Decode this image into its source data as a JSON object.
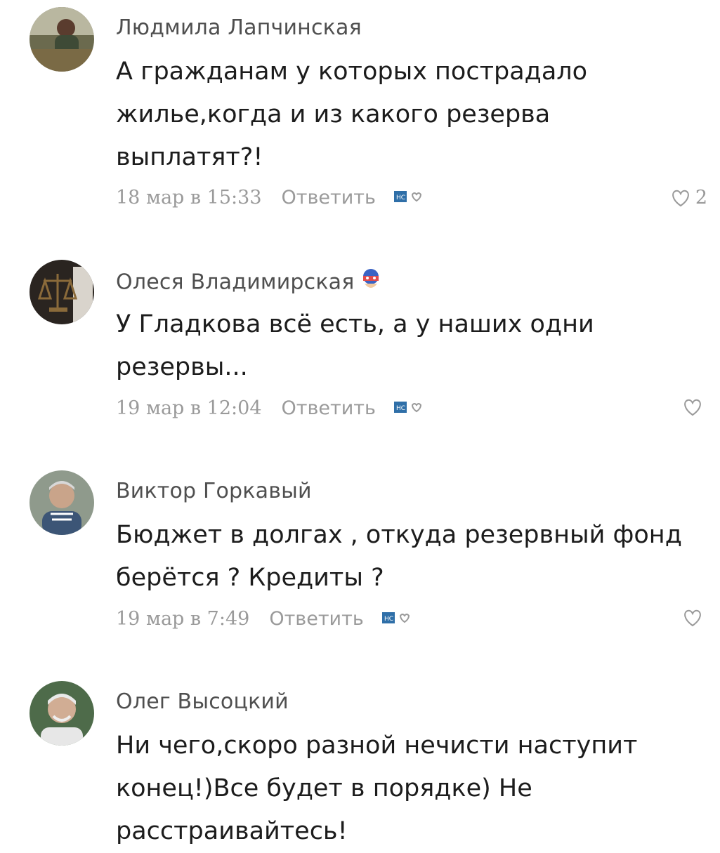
{
  "comments": [
    {
      "author": "Людмила Лапчинская",
      "text": "А гражданам у которых пострадало жилье,когда и из какого резерва выплатят?!",
      "timestamp": "18 мар в 15:33",
      "reply_label": "Ответить",
      "likes": "2",
      "avatar": "avatar-photo"
    },
    {
      "author": "Олеся Владимирская",
      "text": "У Гладкова всё есть, а у наших одни резервы...",
      "timestamp": "19 мар в 12:04",
      "reply_label": "Ответить",
      "likes": "",
      "avatar": "avatar-photo",
      "badge_icon": "hero-mask-icon"
    },
    {
      "author": "Виктор Горкавый",
      "text": "Бюджет в долгах , откуда резервный фонд берётся ? Кредиты ?",
      "timestamp": "19 мар в 7:49",
      "reply_label": "Ответить",
      "likes": "",
      "avatar": "avatar-photo"
    },
    {
      "author": "Олег Высоцкий",
      "text": "Ни чего,скоро разной нечисти наступит конец!)Все будет в порядке) Не расстраивайтесь!",
      "avatar": "avatar-photo"
    }
  ],
  "colors": {
    "author": "#4f4f4f",
    "text": "#1c1c1c",
    "meta": "#9a9a9a",
    "react_badge": "#2f6fa8"
  }
}
